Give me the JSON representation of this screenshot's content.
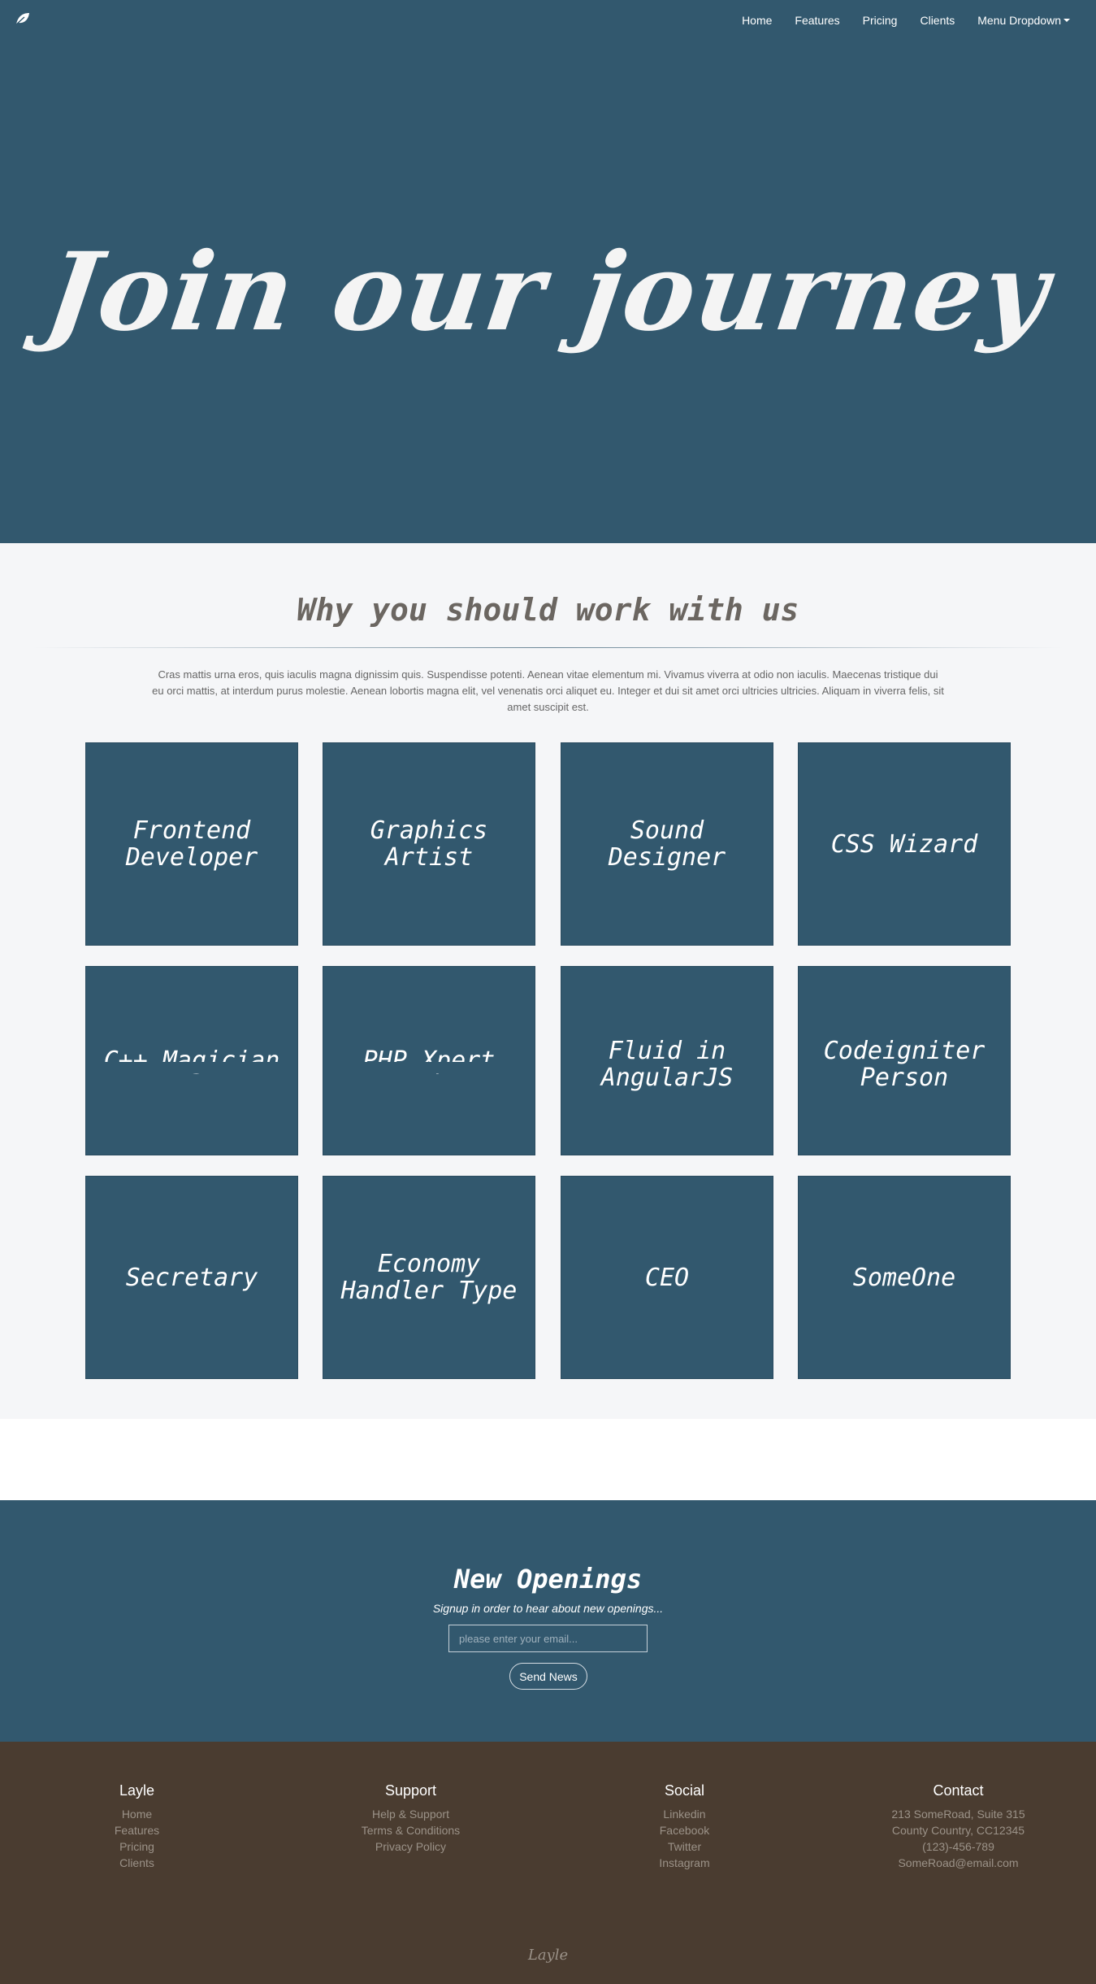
{
  "colors": {
    "primary": "#32586e",
    "section_bg": "#f5f6f8",
    "footer_bg": "#4a3c30",
    "footer_text": "#9b9288",
    "heading_text": "#6b6661"
  },
  "navbar": {
    "brand_icon": "leaf-icon",
    "items": [
      {
        "label": "Home"
      },
      {
        "label": "Features"
      },
      {
        "label": "Pricing"
      },
      {
        "label": "Clients"
      },
      {
        "label": "Menu Dropdown"
      }
    ]
  },
  "hero": {
    "title": "Join our journey"
  },
  "why": {
    "title": "Why you should work with us",
    "text": "Cras mattis urna eros, quis iaculis magna dignissim quis. Suspendisse potenti. Aenean vitae elementum mi. Vivamus viverra at odio non iaculis. Maecenas tristique dui eu orci mattis, at interdum purus molestie. Aenean lobortis magna elit, vel venenatis orci aliquet eu. Integer et dui sit amet orci ultricies ultricies. Aliquam in viverra felis, sit amet suscipit est.",
    "cards": [
      {
        "title": "Frontend Developer"
      },
      {
        "title": "Graphics Artist"
      },
      {
        "title": "Sound Designer"
      },
      {
        "title": "CSS Wizard"
      },
      {
        "title": "C++ Magician"
      },
      {
        "title": "PHP Xpert"
      },
      {
        "title": "Fluid in AngularJS"
      },
      {
        "title": "Codeigniter Person"
      },
      {
        "title": "Secretary"
      },
      {
        "title": "Economy Handler Type"
      },
      {
        "title": "CEO"
      },
      {
        "title": "SomeOne"
      }
    ]
  },
  "openings": {
    "title": "New Openings",
    "subtitle": "Signup in order to hear about new openings...",
    "email_placeholder": "please enter your email...",
    "button_label": "Send News"
  },
  "footer": {
    "columns": [
      {
        "title": "Layle",
        "items": [
          "Home",
          "Features",
          "Pricing",
          "Clients"
        ]
      },
      {
        "title": "Support",
        "items": [
          "Help & Support",
          "Terms & Conditions",
          "Privacy Policy"
        ]
      },
      {
        "title": "Social",
        "items": [
          "Linkedin",
          "Facebook",
          "Twitter",
          "Instagram"
        ]
      },
      {
        "title": "Contact",
        "items": [
          "213 SomeRoad, Suite 315",
          "County Country, CC12345",
          "(123)-456-789",
          "SomeRoad@email.com"
        ]
      }
    ],
    "logo": "Layle"
  }
}
